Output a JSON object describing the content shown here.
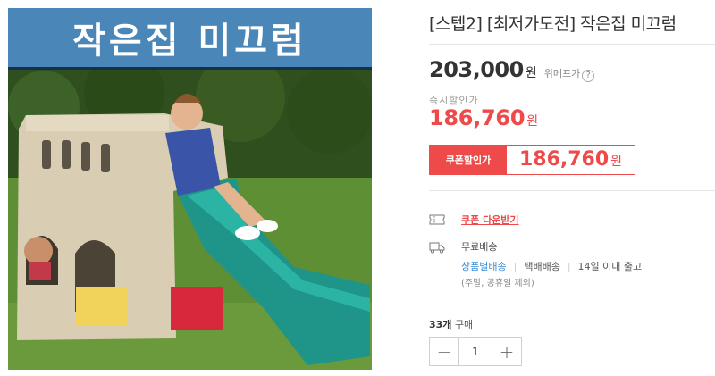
{
  "product_image": {
    "banner_text": "작은집 미끄럼",
    "banner_color": "#4a86b7"
  },
  "product": {
    "title": "[스텝2] [최저가도전] 작은집 미끄럼"
  },
  "price": {
    "original": "203,000",
    "original_unit": "원",
    "wemake_price_label": "위메프가",
    "help_icon": "?",
    "instant_discount_label": "즉시할인가",
    "instant_price": "186,760",
    "instant_unit": "원",
    "coupon_label": "쿠폰할인가",
    "coupon_price": "186,760",
    "coupon_unit": "원",
    "accent_color": "#ee4a4a"
  },
  "coupon_download": {
    "icon": "coupon-icon",
    "label": "쿠폰 다운받기"
  },
  "shipping": {
    "icon": "truck-icon",
    "title": "무료배송",
    "method": "상품별배송",
    "carrier": "택배배송",
    "dispatch": "14일 이내 출고",
    "note": "(주말, 공휴일 제외)"
  },
  "purchase": {
    "count": "33개",
    "count_suffix": "구매",
    "quantity": "1",
    "minus": "−",
    "plus": "+"
  }
}
